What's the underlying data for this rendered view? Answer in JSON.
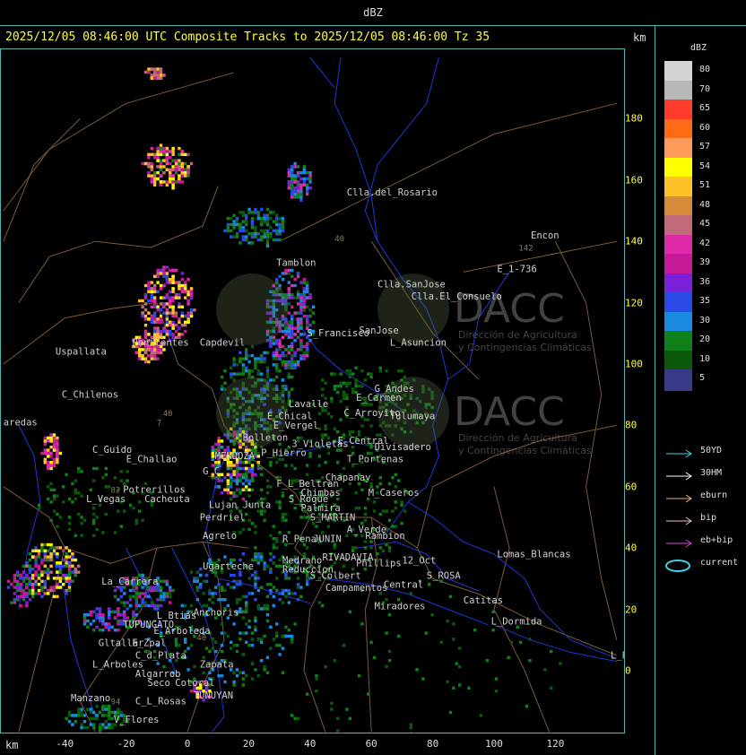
{
  "header": {
    "title": "dBZ"
  },
  "subtitle": "2025/12/05 08:46:00 UTC Composite Tracks to 2025/12/05 08:46:00 Tz 35",
  "km_label": "km",
  "axes": {
    "x_ticks": [
      "-40",
      "-20",
      "0",
      "20",
      "40",
      "60",
      "80",
      "100",
      "120"
    ],
    "y_ticks": [
      "180",
      "160",
      "140",
      "120",
      "100",
      "80",
      "60",
      "40",
      "20",
      "0"
    ]
  },
  "legend": {
    "title": "dBZ",
    "levels": [
      {
        "value": "80",
        "color": "#d4d4d4"
      },
      {
        "value": "70",
        "color": "#b8b8b8"
      },
      {
        "value": "65",
        "color": "#ff3a2a"
      },
      {
        "value": "60",
        "color": "#ff6a14"
      },
      {
        "value": "57",
        "color": "#ff9a5a"
      },
      {
        "value": "54",
        "color": "#ffff00"
      },
      {
        "value": "51",
        "color": "#ffc02a"
      },
      {
        "value": "48",
        "color": "#d68a3a"
      },
      {
        "value": "45",
        "color": "#c06a7a"
      },
      {
        "value": "42",
        "color": "#e02aa8"
      },
      {
        "value": "39",
        "color": "#c41a9a"
      },
      {
        "value": "36",
        "color": "#7a20d8"
      },
      {
        "value": "35",
        "color": "#2a4ae8"
      },
      {
        "value": "30",
        "color": "#1a8ae0"
      },
      {
        "value": "20",
        "color": "#10801a"
      },
      {
        "value": "10",
        "color": "#0a5a0a"
      },
      {
        "value": "5",
        "color": "#3a3a8a"
      }
    ],
    "tracks": [
      {
        "label": "50YD",
        "color": "#3cd4e8"
      },
      {
        "label": "30HM",
        "color": "#ffffff"
      },
      {
        "label": "eburn",
        "color": "#e8b46a"
      },
      {
        "label": "bip",
        "color": "#f0c0c8"
      },
      {
        "label": "eb+bip",
        "color": "#e040e0"
      },
      {
        "label": "current",
        "color": "#3cd4e8"
      }
    ]
  },
  "watermark": {
    "org": "DACC",
    "line1": "Dirección de Agricultura",
    "line2": "y Contingencias Climáticas"
  },
  "places": [
    {
      "name": "Clla.del_Rosario",
      "x": 52,
      "y": 155,
      "kind": "white"
    },
    {
      "name": "Encon",
      "x": 112,
      "y": 141,
      "kind": "white"
    },
    {
      "name": "E_1-736",
      "x": 101,
      "y": 130,
      "kind": "white"
    },
    {
      "name": "142",
      "x": 108,
      "y": 137,
      "kind": "route"
    },
    {
      "name": "Clla.SanJose",
      "x": 62,
      "y": 125,
      "kind": "white"
    },
    {
      "name": "Clla.El_Consuelo",
      "x": 73,
      "y": 121,
      "kind": "white"
    },
    {
      "name": "Tamblon",
      "x": 29,
      "y": 132,
      "kind": "white"
    },
    {
      "name": "SanJose",
      "x": 56,
      "y": 110,
      "kind": "white"
    },
    {
      "name": "L_Asuncion",
      "x": 66,
      "y": 106,
      "kind": "white"
    },
    {
      "name": "S_Francisco",
      "x": 39,
      "y": 109,
      "kind": "white"
    },
    {
      "name": "Capdevil",
      "x": 4,
      "y": 106,
      "kind": "white"
    },
    {
      "name": "Uspallata",
      "x": -43,
      "y": 103,
      "kind": "white"
    },
    {
      "name": "G_Andes",
      "x": 61,
      "y": 91,
      "kind": "white"
    },
    {
      "name": "E_Carmen",
      "x": 55,
      "y": 88,
      "kind": "white"
    },
    {
      "name": "Lavalle",
      "x": 33,
      "y": 86,
      "kind": "white"
    },
    {
      "name": "C_Chilenos",
      "x": -41,
      "y": 89,
      "kind": "white"
    },
    {
      "name": "E_Chical",
      "x": 26,
      "y": 82,
      "kind": "white"
    },
    {
      "name": "C_Arroyito",
      "x": 51,
      "y": 83,
      "kind": "white"
    },
    {
      "name": "Tulumaya",
      "x": 66,
      "y": 82,
      "kind": "white"
    },
    {
      "name": "E_Vergel",
      "x": 28,
      "y": 79,
      "kind": "white"
    },
    {
      "name": "Bolleton",
      "x": 18,
      "y": 75,
      "kind": "white"
    },
    {
      "name": "3_Violetas",
      "x": 34,
      "y": 73,
      "kind": "white"
    },
    {
      "name": "E_Central",
      "x": 49,
      "y": 74,
      "kind": "white"
    },
    {
      "name": "Divisadero",
      "x": 61,
      "y": 72,
      "kind": "white"
    },
    {
      "name": "C_Guido",
      "x": -31,
      "y": 71,
      "kind": "white"
    },
    {
      "name": "P_Hierro",
      "x": 24,
      "y": 70,
      "kind": "white"
    },
    {
      "name": "T_Portenas",
      "x": 52,
      "y": 68,
      "kind": "white"
    },
    {
      "name": "E_Challao",
      "x": -20,
      "y": 68,
      "kind": "white"
    },
    {
      "name": "MENDOZA",
      "x": 9,
      "y": 69,
      "kind": "white"
    },
    {
      "name": "G_C",
      "x": 5,
      "y": 64,
      "kind": "white"
    },
    {
      "name": "F_L_Beltran",
      "x": 29,
      "y": 60,
      "kind": "white"
    },
    {
      "name": "Chapanay",
      "x": 45,
      "y": 62,
      "kind": "white"
    },
    {
      "name": "Chimbas",
      "x": 37,
      "y": 57,
      "kind": "white"
    },
    {
      "name": "M_Caseros",
      "x": 59,
      "y": 57,
      "kind": "white"
    },
    {
      "name": "Potrerillos",
      "x": -21,
      "y": 58,
      "kind": "white"
    },
    {
      "name": "L_Vegas",
      "x": -33,
      "y": 55,
      "kind": "white"
    },
    {
      "name": "Cacheuta",
      "x": -14,
      "y": 55,
      "kind": "white"
    },
    {
      "name": "S_Roque",
      "x": 33,
      "y": 55,
      "kind": "white"
    },
    {
      "name": "Palmira",
      "x": 37,
      "y": 52,
      "kind": "white"
    },
    {
      "name": "Lujan",
      "x": 7,
      "y": 53,
      "kind": "white"
    },
    {
      "name": "Junta",
      "x": 18,
      "y": 53,
      "kind": "white"
    },
    {
      "name": "S_MARTIN",
      "x": 40,
      "y": 49,
      "kind": "white"
    },
    {
      "name": "Perdriel",
      "x": 4,
      "y": 49,
      "kind": "white"
    },
    {
      "name": "A_Verde",
      "x": 52,
      "y": 45,
      "kind": "white"
    },
    {
      "name": "Rambion",
      "x": 58,
      "y": 43,
      "kind": "white"
    },
    {
      "name": "Agrelo",
      "x": 5,
      "y": 43,
      "kind": "white"
    },
    {
      "name": "R_Pena",
      "x": 31,
      "y": 42,
      "kind": "white"
    },
    {
      "name": "JUNIN",
      "x": 41,
      "y": 42,
      "kind": "white"
    },
    {
      "name": "Lomas_Blancas",
      "x": 101,
      "y": 37,
      "kind": "white"
    },
    {
      "name": "12_Oct",
      "x": 70,
      "y": 35,
      "kind": "white"
    },
    {
      "name": "Medrano",
      "x": 31,
      "y": 35,
      "kind": "white"
    },
    {
      "name": "RIVADAVIA",
      "x": 44,
      "y": 36,
      "kind": "white"
    },
    {
      "name": "Phillips",
      "x": 55,
      "y": 34,
      "kind": "white"
    },
    {
      "name": "Ugarteche",
      "x": 5,
      "y": 33,
      "kind": "white"
    },
    {
      "name": "Reduccion",
      "x": 31,
      "y": 32,
      "kind": "white"
    },
    {
      "name": "S_Colbert",
      "x": 40,
      "y": 30,
      "kind": "white"
    },
    {
      "name": "S_ROSA",
      "x": 78,
      "y": 30,
      "kind": "white"
    },
    {
      "name": "La_Carrera",
      "x": -28,
      "y": 28,
      "kind": "white"
    },
    {
      "name": "Campamentos",
      "x": 45,
      "y": 26,
      "kind": "white"
    },
    {
      "name": "Central",
      "x": 64,
      "y": 27,
      "kind": "white"
    },
    {
      "name": "Catitas",
      "x": 90,
      "y": 22,
      "kind": "white"
    },
    {
      "name": "Miradores",
      "x": 61,
      "y": 20,
      "kind": "white"
    },
    {
      "name": "Anchoris",
      "x": 2,
      "y": 18,
      "kind": "white"
    },
    {
      "name": "L_Btias",
      "x": -10,
      "y": 17,
      "kind": "white"
    },
    {
      "name": "TUPUNGATO",
      "x": -21,
      "y": 14,
      "kind": "white"
    },
    {
      "name": "L_Dormida",
      "x": 99,
      "y": 15,
      "kind": "white"
    },
    {
      "name": "E_Arboleda",
      "x": -11,
      "y": 12,
      "kind": "white"
    },
    {
      "name": "Gltallar",
      "x": -29,
      "y": 8,
      "kind": "white"
    },
    {
      "name": "E_Zpal",
      "x": -18,
      "y": 8,
      "kind": "white"
    },
    {
      "name": "C_d_Plata",
      "x": -17,
      "y": 4,
      "kind": "white"
    },
    {
      "name": "L_Arboles",
      "x": -31,
      "y": 1,
      "kind": "white"
    },
    {
      "name": "Zapata",
      "x": 4,
      "y": 1,
      "kind": "white"
    },
    {
      "name": "L_PAZ",
      "x": 138,
      "y": 4,
      "kind": "white"
    },
    {
      "name": "Algarrob",
      "x": -17,
      "y": -2,
      "kind": "white"
    },
    {
      "name": "Seco",
      "x": -13,
      "y": -5,
      "kind": "white"
    },
    {
      "name": "Cotoral",
      "x": -4,
      "y": -5,
      "kind": "white"
    },
    {
      "name": "TUNUYAN",
      "x": 2,
      "y": -9,
      "kind": "white"
    },
    {
      "name": "Manzano",
      "x": -38,
      "y": -10,
      "kind": "white"
    },
    {
      "name": "C_L_Rosas",
      "x": -17,
      "y": -11,
      "kind": "white"
    },
    {
      "name": "V_Flores",
      "x": -24,
      "y": -17,
      "kind": "white"
    },
    {
      "name": "aredas",
      "x": -60,
      "y": 80,
      "kind": "white"
    },
    {
      "name": "Penitentes",
      "x": -18,
      "y": 106,
      "kind": "white"
    },
    {
      "name": "40",
      "x": 48,
      "y": 140,
      "kind": "route"
    },
    {
      "name": "40",
      "x": -8,
      "y": 83,
      "kind": "route"
    },
    {
      "name": "82",
      "x": -25,
      "y": 58,
      "kind": "route"
    },
    {
      "name": "7",
      "x": -10,
      "y": 80,
      "kind": "route"
    },
    {
      "name": "40",
      "x": 3,
      "y": 10,
      "kind": "route"
    },
    {
      "name": "94",
      "x": -25,
      "y": -11,
      "kind": "route"
    }
  ]
}
